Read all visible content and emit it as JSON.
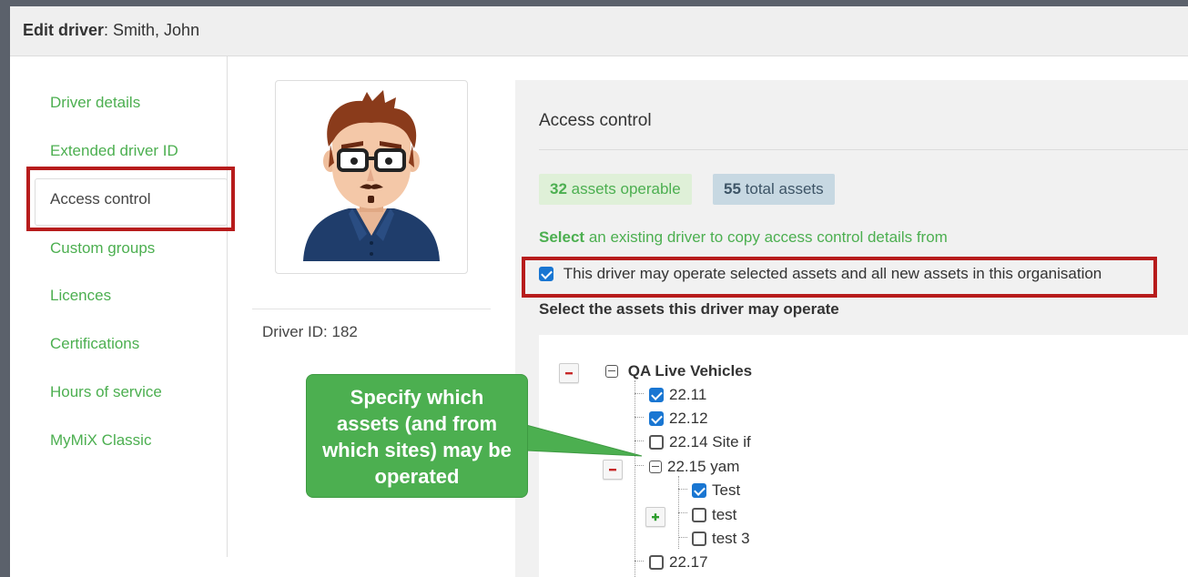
{
  "header": {
    "title_bold": "Edit driver",
    "title_rest": ": Smith, John"
  },
  "nav": {
    "items": [
      {
        "label": "Driver details"
      },
      {
        "label": "Extended driver ID"
      },
      {
        "label": "Access control"
      },
      {
        "label": "Custom groups"
      },
      {
        "label": "Licences"
      },
      {
        "label": "Certifications"
      },
      {
        "label": "Hours of service"
      },
      {
        "label": "MyMiX Classic"
      }
    ],
    "active": "Access control"
  },
  "driver": {
    "id_text": "Driver ID: 182",
    "avatar_icon": "driver-avatar-illustration"
  },
  "access": {
    "title": "Access control",
    "operable_count": "32",
    "operable_label": " assets operable",
    "total_count": "55",
    "total_label": " total assets",
    "select_bold": "Select",
    "select_rest": " an existing driver to copy access control details from",
    "all_new_label": "This driver may operate selected assets and all new assets in this organisation",
    "all_new_checked": true,
    "assets_heading": "Select the assets this driver may operate"
  },
  "tree": {
    "root": "QA Live Vehicles",
    "items": [
      {
        "label": "22.11",
        "checked": true
      },
      {
        "label": "22.12",
        "checked": true
      },
      {
        "label": "22.14 Site if",
        "checked": false
      },
      {
        "label": "22.15 yam",
        "group": true
      },
      {
        "label": "Test",
        "checked": true
      },
      {
        "label": "test",
        "checked": false
      },
      {
        "label": "test 3",
        "checked": false
      },
      {
        "label": "22.17",
        "checked": false
      }
    ]
  },
  "callout": {
    "lines": [
      "Specify which",
      "assets (and from",
      "which sites) may be",
      "operated"
    ]
  },
  "colors": {
    "accent_green": "#4caf50",
    "highlight_red": "#b71c1c",
    "checkbox_blue": "#1976d2"
  }
}
